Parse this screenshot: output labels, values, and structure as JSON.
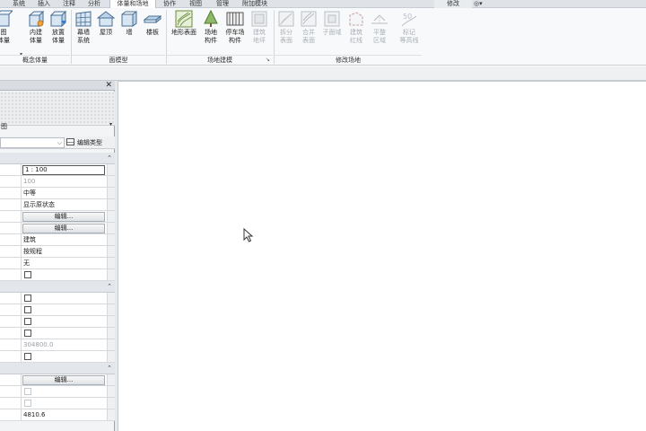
{
  "tabs": [
    {
      "label": "系统"
    },
    {
      "label": "插入"
    },
    {
      "label": "注释"
    },
    {
      "label": "分析"
    },
    {
      "label": "体量和场地"
    },
    {
      "label": "协作"
    },
    {
      "label": "视图"
    },
    {
      "label": "管理"
    },
    {
      "label": "附加模块"
    }
  ],
  "active_tab": "体量和场地",
  "modify_tab": "修改",
  "view_switch": "◎▾",
  "ribbon": {
    "conceptual_mass": {
      "title": "概念体量",
      "buttons": [
        {
          "label": "图\n体量",
          "icon": "show-mass-icon"
        },
        {
          "label": "内建\n体量",
          "icon": "in-place-mass-icon"
        },
        {
          "label": "放置\n体量",
          "icon": "place-mass-icon"
        }
      ]
    },
    "model_by_face": {
      "title": "面模型",
      "buttons": [
        {
          "label": "幕墙\n系统",
          "icon": "curtain-system-icon"
        },
        {
          "label": "屋顶",
          "icon": "roof-icon"
        },
        {
          "label": "墙",
          "icon": "wall-icon"
        },
        {
          "label": "楼板",
          "icon": "floor-icon"
        }
      ]
    },
    "site_modeling": {
      "title": "场地建模",
      "buttons": [
        {
          "label": "地形表面",
          "icon": "toposurface-icon"
        },
        {
          "label": "场地\n构件",
          "icon": "site-component-icon"
        },
        {
          "label": "停车场\n构件",
          "icon": "parking-component-icon"
        },
        {
          "label": "建筑\n地坪",
          "icon": "building-pad-icon",
          "disabled": true
        }
      ],
      "launcher": "↘"
    },
    "modify_site": {
      "title": "修改场地",
      "buttons": [
        {
          "label": "拆分\n表面",
          "icon": "split-surface-icon"
        },
        {
          "label": "合并\n表面",
          "icon": "merge-surfaces-icon"
        },
        {
          "label": "子面域",
          "icon": "subregion-icon"
        },
        {
          "label": "建筑\n红线",
          "icon": "property-line-icon"
        },
        {
          "label": "平整\n区域",
          "icon": "graded-region-icon"
        },
        {
          "label": "标记\n等高线",
          "icon": "label-contours-icon"
        }
      ]
    }
  },
  "properties": {
    "close_glyph": "✕",
    "type_name": "图",
    "type_arrow": "▾",
    "filter_arrow": "⌵",
    "edit_type_label": "编辑类型",
    "group_caret": "⌃",
    "rows": {
      "r1": "1 : 100",
      "r2": "100",
      "r3": "中等",
      "r4": "显示原状态",
      "r5": "编辑...",
      "r6": "编辑...",
      "r7": "建筑",
      "r8": "按规程",
      "r9": "无",
      "r15": "304800.0",
      "r17": "编辑...",
      "r20": "4810.6"
    }
  },
  "colors": {
    "ribbon_bg": "#f8f9fa",
    "tab_bar": "#dfe3e8",
    "palette_bg": "#f3f4f6",
    "disabled_text": "#a9b0b8"
  }
}
